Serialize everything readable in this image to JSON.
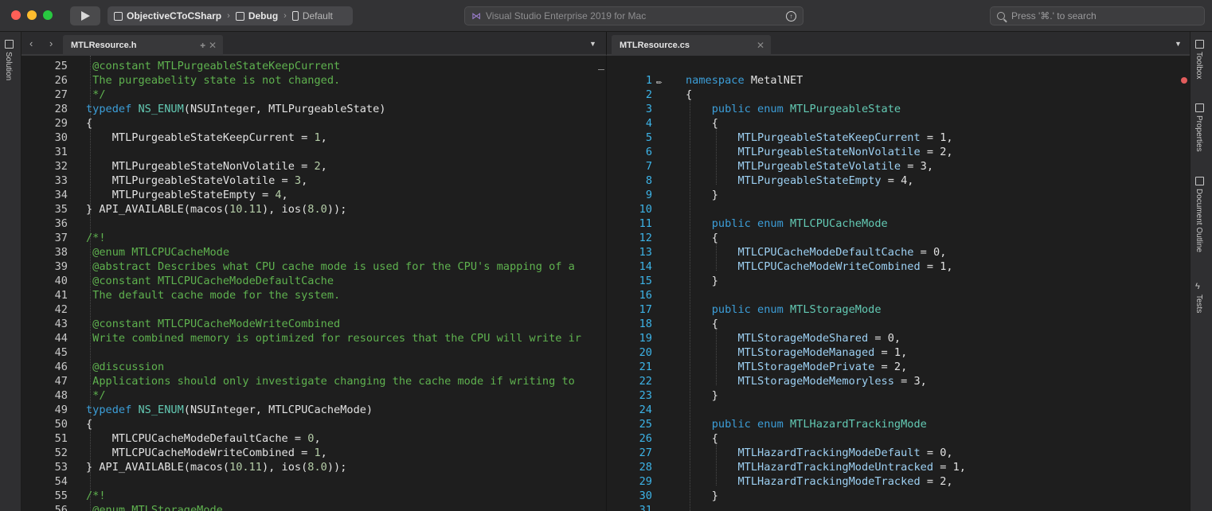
{
  "titlebar": {
    "project": "ObjectiveCToCSharp",
    "configuration": "Debug",
    "device": "Default",
    "status": "Visual Studio Enterprise 2019 for Mac",
    "search_placeholder": "Press '⌘.' to search"
  },
  "left_pad": {
    "items": [
      {
        "label": "Solution"
      }
    ]
  },
  "right_pad": {
    "items": [
      {
        "label": "Toolbox"
      },
      {
        "label": "Properties"
      },
      {
        "label": "Document Outline"
      },
      {
        "label": "Tests"
      }
    ]
  },
  "left_editor": {
    "tab_title": "MTLResource.h",
    "lines": [
      {
        "n": "25",
        "tokens": [
          [
            " @constant MTLPurgeableStateKeepCurrent",
            "c"
          ]
        ]
      },
      {
        "n": "26",
        "tokens": [
          [
            " The purgeabelity state is not changed.",
            "c"
          ]
        ]
      },
      {
        "n": "27",
        "tokens": [
          [
            " */",
            "c"
          ]
        ]
      },
      {
        "n": "28",
        "tokens": [
          [
            "typedef ",
            "k"
          ],
          [
            "NS_ENUM",
            "t"
          ],
          [
            "(NSUInteger, MTLPurgeableState)",
            ""
          ]
        ]
      },
      {
        "n": "29",
        "tokens": [
          [
            "{",
            ""
          ]
        ]
      },
      {
        "n": "30",
        "tokens": [
          [
            "    MTLPurgeableStateKeepCurrent = ",
            ""
          ],
          [
            "1",
            "n"
          ],
          [
            ",",
            ""
          ]
        ]
      },
      {
        "n": "31",
        "tokens": []
      },
      {
        "n": "32",
        "tokens": [
          [
            "    MTLPurgeableStateNonVolatile = ",
            ""
          ],
          [
            "2",
            "n"
          ],
          [
            ",",
            ""
          ]
        ]
      },
      {
        "n": "33",
        "tokens": [
          [
            "    MTLPurgeableStateVolatile = ",
            ""
          ],
          [
            "3",
            "n"
          ],
          [
            ",",
            ""
          ]
        ]
      },
      {
        "n": "34",
        "tokens": [
          [
            "    MTLPurgeableStateEmpty = ",
            ""
          ],
          [
            "4",
            "n"
          ],
          [
            ",",
            ""
          ]
        ]
      },
      {
        "n": "35",
        "tokens": [
          [
            "} API_AVAILABLE(macos(",
            ""
          ],
          [
            "10.11",
            "n"
          ],
          [
            "), ios(",
            ""
          ],
          [
            "8.0",
            "n"
          ],
          [
            "));",
            ""
          ]
        ]
      },
      {
        "n": "36",
        "tokens": []
      },
      {
        "n": "37",
        "tokens": [
          [
            "/*!",
            "c"
          ]
        ]
      },
      {
        "n": "38",
        "tokens": [
          [
            " @enum MTLCPUCacheMode",
            "c"
          ]
        ]
      },
      {
        "n": "39",
        "tokens": [
          [
            " @abstract Describes what CPU cache mode is used for the CPU's mapping of a",
            "c"
          ]
        ]
      },
      {
        "n": "40",
        "tokens": [
          [
            " @constant MTLCPUCacheModeDefaultCache",
            "c"
          ]
        ]
      },
      {
        "n": "41",
        "tokens": [
          [
            " The default cache mode for the system.",
            "c"
          ]
        ]
      },
      {
        "n": "42",
        "tokens": []
      },
      {
        "n": "43",
        "tokens": [
          [
            " @constant MTLCPUCacheModeWriteCombined",
            "c"
          ]
        ]
      },
      {
        "n": "44",
        "tokens": [
          [
            " Write combined memory is optimized for resources that the CPU will write ir",
            "c"
          ]
        ]
      },
      {
        "n": "45",
        "tokens": []
      },
      {
        "n": "46",
        "tokens": [
          [
            " @discussion",
            "c"
          ]
        ]
      },
      {
        "n": "47",
        "tokens": [
          [
            " Applications should only investigate changing the cache mode if writing to",
            "c"
          ]
        ]
      },
      {
        "n": "48",
        "tokens": [
          [
            " */",
            "c"
          ]
        ]
      },
      {
        "n": "49",
        "tokens": [
          [
            "typedef ",
            "k"
          ],
          [
            "NS_ENUM",
            "t"
          ],
          [
            "(NSUInteger, MTLCPUCacheMode)",
            ""
          ]
        ]
      },
      {
        "n": "50",
        "tokens": [
          [
            "{",
            ""
          ]
        ]
      },
      {
        "n": "51",
        "tokens": [
          [
            "    MTLCPUCacheModeDefaultCache = ",
            ""
          ],
          [
            "0",
            "n"
          ],
          [
            ",",
            ""
          ]
        ]
      },
      {
        "n": "52",
        "tokens": [
          [
            "    MTLCPUCacheModeWriteCombined = ",
            ""
          ],
          [
            "1",
            "n"
          ],
          [
            ",",
            ""
          ]
        ]
      },
      {
        "n": "53",
        "tokens": [
          [
            "} API_AVAILABLE(macos(",
            ""
          ],
          [
            "10.11",
            "n"
          ],
          [
            "), ios(",
            ""
          ],
          [
            "8.0",
            "n"
          ],
          [
            "));",
            ""
          ]
        ]
      },
      {
        "n": "54",
        "tokens": []
      },
      {
        "n": "55",
        "tokens": [
          [
            "/*!",
            "c"
          ]
        ]
      },
      {
        "n": "56",
        "tokens": [
          [
            " @enum MTLStorageMode",
            "c"
          ]
        ]
      }
    ]
  },
  "right_editor": {
    "tab_title": "MTLResource.cs",
    "lines": [
      {
        "n": "1",
        "tokens": [
          [
            "namespace ",
            "k"
          ],
          [
            "MetalNET",
            ""
          ]
        ]
      },
      {
        "n": "2",
        "tokens": [
          [
            "{",
            ""
          ]
        ]
      },
      {
        "n": "3",
        "tokens": [
          [
            "    public enum ",
            "k"
          ],
          [
            "MTLPurgeableState",
            "t"
          ]
        ]
      },
      {
        "n": "4",
        "tokens": [
          [
            "    {",
            ""
          ]
        ]
      },
      {
        "n": "5",
        "tokens": [
          [
            "        ",
            ""
          ],
          [
            "MTLPurgeableStateKeepCurrent",
            "id"
          ],
          [
            " = 1,",
            ""
          ]
        ]
      },
      {
        "n": "6",
        "tokens": [
          [
            "        ",
            ""
          ],
          [
            "MTLPurgeableStateNonVolatile",
            "id"
          ],
          [
            " = 2,",
            ""
          ]
        ]
      },
      {
        "n": "7",
        "tokens": [
          [
            "        ",
            ""
          ],
          [
            "MTLPurgeableStateVolatile",
            "id"
          ],
          [
            " = 3,",
            ""
          ]
        ]
      },
      {
        "n": "8",
        "tokens": [
          [
            "        ",
            ""
          ],
          [
            "MTLPurgeableStateEmpty",
            "id"
          ],
          [
            " = 4,",
            ""
          ]
        ]
      },
      {
        "n": "9",
        "tokens": [
          [
            "    }",
            ""
          ]
        ]
      },
      {
        "n": "10",
        "tokens": []
      },
      {
        "n": "11",
        "tokens": [
          [
            "    public enum ",
            "k"
          ],
          [
            "MTLCPUCacheMode",
            "t"
          ]
        ]
      },
      {
        "n": "12",
        "tokens": [
          [
            "    {",
            ""
          ]
        ]
      },
      {
        "n": "13",
        "tokens": [
          [
            "        ",
            ""
          ],
          [
            "MTLCPUCacheModeDefaultCache",
            "id"
          ],
          [
            " = 0,",
            ""
          ]
        ]
      },
      {
        "n": "14",
        "tokens": [
          [
            "        ",
            ""
          ],
          [
            "MTLCPUCacheModeWriteCombined",
            "id"
          ],
          [
            " = 1,",
            ""
          ]
        ]
      },
      {
        "n": "15",
        "tokens": [
          [
            "    }",
            ""
          ]
        ]
      },
      {
        "n": "16",
        "tokens": []
      },
      {
        "n": "17",
        "tokens": [
          [
            "    public enum ",
            "k"
          ],
          [
            "MTLStorageMode",
            "t"
          ]
        ]
      },
      {
        "n": "18",
        "tokens": [
          [
            "    {",
            ""
          ]
        ]
      },
      {
        "n": "19",
        "tokens": [
          [
            "        ",
            ""
          ],
          [
            "MTLStorageModeShared",
            "id"
          ],
          [
            " = 0,",
            ""
          ]
        ]
      },
      {
        "n": "20",
        "tokens": [
          [
            "        ",
            ""
          ],
          [
            "MTLStorageModeManaged",
            "id"
          ],
          [
            " = 1,",
            ""
          ]
        ]
      },
      {
        "n": "21",
        "tokens": [
          [
            "        ",
            ""
          ],
          [
            "MTLStorageModePrivate",
            "id"
          ],
          [
            " = 2,",
            ""
          ]
        ]
      },
      {
        "n": "22",
        "tokens": [
          [
            "        ",
            ""
          ],
          [
            "MTLStorageModeMemoryless",
            "id"
          ],
          [
            " = 3,",
            ""
          ]
        ]
      },
      {
        "n": "23",
        "tokens": [
          [
            "    }",
            ""
          ]
        ]
      },
      {
        "n": "24",
        "tokens": []
      },
      {
        "n": "25",
        "tokens": [
          [
            "    public enum ",
            "k"
          ],
          [
            "MTLHazardTrackingMode",
            "t"
          ]
        ]
      },
      {
        "n": "26",
        "tokens": [
          [
            "    {",
            ""
          ]
        ]
      },
      {
        "n": "27",
        "tokens": [
          [
            "        ",
            ""
          ],
          [
            "MTLHazardTrackingModeDefault",
            "id"
          ],
          [
            " = 0,",
            ""
          ]
        ]
      },
      {
        "n": "28",
        "tokens": [
          [
            "        ",
            ""
          ],
          [
            "MTLHazardTrackingModeUntracked",
            "id"
          ],
          [
            " = 1,",
            ""
          ]
        ]
      },
      {
        "n": "29",
        "tokens": [
          [
            "        ",
            ""
          ],
          [
            "MTLHazardTrackingModeTracked",
            "id"
          ],
          [
            " = 2,",
            ""
          ]
        ]
      },
      {
        "n": "30",
        "tokens": [
          [
            "    }",
            ""
          ]
        ]
      },
      {
        "n": "31",
        "tokens": []
      }
    ]
  }
}
